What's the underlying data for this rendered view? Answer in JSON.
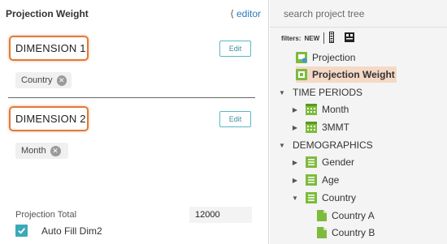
{
  "left_panel": {
    "title": "Projection Weight",
    "editor_link": "editor",
    "dimension1": {
      "label": "DIMENSION 1",
      "edit_label": "Edit",
      "chip": "Country"
    },
    "dimension2": {
      "label": "DIMENSION 2",
      "edit_label": "Edit",
      "chip": "Month"
    },
    "projection_total_label": "Projection Total",
    "projection_total_value": "12000",
    "auto_fill_label": "Auto Fill Dim2",
    "auto_fill_checked": true
  },
  "right_panel": {
    "search_placeholder": "search project tree",
    "filters_label": "filters:",
    "filters_new": "NEW",
    "tree": {
      "projection": "Projection",
      "projection_weight": "Projection Weight",
      "time_periods": "TIME PERIODS",
      "month": "Month",
      "threemmt": "3MMT",
      "demographics": "DEMOGRAPHICS",
      "gender": "Gender",
      "age": "Age",
      "country": "Country",
      "country_a": "Country A",
      "country_b": "Country B"
    }
  },
  "colors": {
    "highlight_border": "#e07b39",
    "accent_teal": "#3aa9b8",
    "link_blue": "#2a7ab8",
    "tree_green": "#7dbb3c",
    "selected_bg": "#f5d9c6"
  }
}
